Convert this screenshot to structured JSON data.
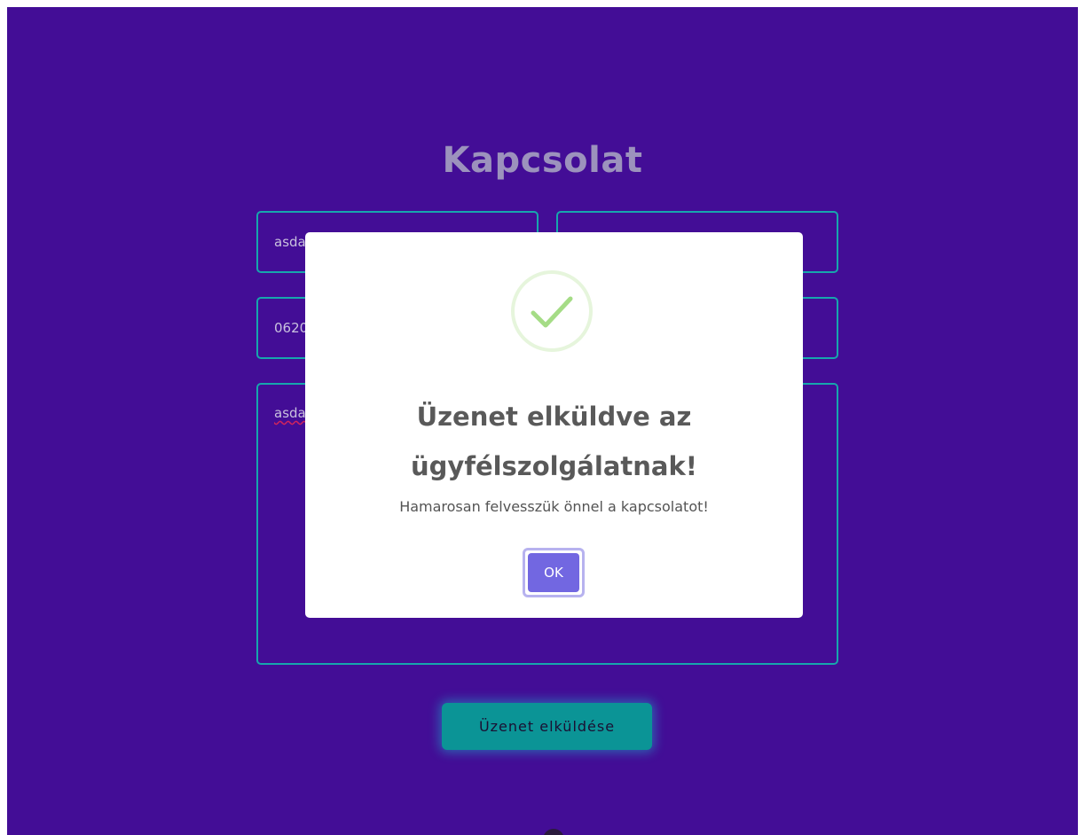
{
  "page": {
    "title": "Kapcsolat"
  },
  "form": {
    "name_value": "asdasd",
    "email_value": "",
    "phone_value": "06201234567",
    "subject_value": "",
    "message_value": "asdasd",
    "submit_label": "Üzenet elküldése"
  },
  "modal": {
    "icon": "check-icon",
    "title": "Üzenet elküldve az ügyfélszolgálatnak!",
    "text": "Hamarosan felvesszük önnel a kapcsolatot!",
    "ok_label": "OK"
  },
  "colors": {
    "background": "#430d96",
    "field_border": "#17a6ad",
    "submit_button": "#0b9496",
    "ok_button": "#7267e1",
    "success_check": "#a5dc86"
  }
}
